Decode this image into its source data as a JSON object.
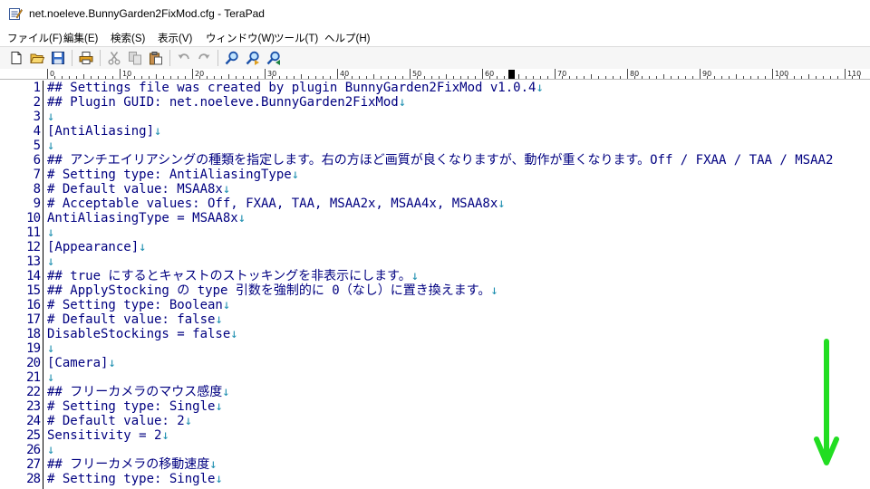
{
  "window": {
    "title": "net.noeleve.BunnyGarden2FixMod.cfg - TeraPad",
    "icon": "terapad-notepad-icon"
  },
  "menu": [
    "ファイル(F)",
    "編集(E)",
    "検索(S)",
    "表示(V)",
    "ウィンドウ(W)",
    "ツール(T)",
    "ヘルプ(H)"
  ],
  "toolbar": [
    {
      "name": "new-file-icon"
    },
    {
      "name": "open-folder-icon"
    },
    {
      "name": "save-icon"
    },
    {
      "name": "print-icon"
    },
    {
      "name": "cut-icon"
    },
    {
      "name": "copy-icon"
    },
    {
      "name": "paste-icon"
    },
    {
      "name": "undo-icon"
    },
    {
      "name": "redo-icon"
    },
    {
      "name": "find-icon"
    },
    {
      "name": "find-next-icon"
    },
    {
      "name": "find-prev-icon"
    }
  ],
  "ruler": {
    "labels": [
      "0",
      "10",
      "20",
      "30",
      "40",
      "50",
      "60",
      "70",
      "80",
      "90",
      "100",
      "110"
    ],
    "caret_column": 64
  },
  "editor": {
    "lines": [
      {
        "n": "1",
        "text": "## Settings file was created by plugin BunnyGarden2FixMod v1.0.4",
        "eol": "↓"
      },
      {
        "n": "2",
        "text": "## Plugin GUID: net.noeleve.BunnyGarden2FixMod",
        "eol": "↓"
      },
      {
        "n": "3",
        "text": "",
        "eol": "↓"
      },
      {
        "n": "4",
        "text": "[AntiAliasing]",
        "eol": "↓"
      },
      {
        "n": "5",
        "text": "",
        "eol": "↓"
      },
      {
        "n": "6",
        "text": "## アンチエイリアシングの種類を指定します。右の方ほど画質が良くなりますが、動作が重くなります。Off / FXAA / TAA / MSAA2",
        "eol": ""
      },
      {
        "n": "7",
        "text": "# Setting type: AntiAliasingType",
        "eol": "↓"
      },
      {
        "n": "8",
        "text": "# Default value: MSAA8x",
        "eol": "↓"
      },
      {
        "n": "9",
        "text": "# Acceptable values: Off, FXAA, TAA, MSAA2x, MSAA4x, MSAA8x",
        "eol": "↓"
      },
      {
        "n": "10",
        "text": "AntiAliasingType = MSAA8x",
        "eol": "↓"
      },
      {
        "n": "11",
        "text": "",
        "eol": "↓"
      },
      {
        "n": "12",
        "text": "[Appearance]",
        "eol": "↓"
      },
      {
        "n": "13",
        "text": "",
        "eol": "↓"
      },
      {
        "n": "14",
        "text": "## true にするとキャストのストッキングを非表示にします。",
        "eol": "↓"
      },
      {
        "n": "15",
        "text": "## ApplyStocking の type 引数を強制的に 0（なし）に置き換えます。",
        "eol": "↓"
      },
      {
        "n": "16",
        "text": "# Setting type: Boolean",
        "eol": "↓"
      },
      {
        "n": "17",
        "text": "# Default value: false",
        "eol": "↓"
      },
      {
        "n": "18",
        "text": "DisableStockings = false",
        "eol": "↓"
      },
      {
        "n": "19",
        "text": "",
        "eol": "↓"
      },
      {
        "n": "20",
        "text": "[Camera]",
        "eol": "↓"
      },
      {
        "n": "21",
        "text": "",
        "eol": "↓"
      },
      {
        "n": "22",
        "text": "## フリーカメラのマウス感度",
        "eol": "↓"
      },
      {
        "n": "23",
        "text": "# Setting type: Single",
        "eol": "↓"
      },
      {
        "n": "24",
        "text": "# Default value: 2",
        "eol": "↓"
      },
      {
        "n": "25",
        "text": "Sensitivity = 2",
        "eol": "↓"
      },
      {
        "n": "26",
        "text": "",
        "eol": "↓"
      },
      {
        "n": "27",
        "text": "## フリーカメラの移動速度",
        "eol": "↓"
      },
      {
        "n": "28",
        "text": "# Setting type: Single",
        "eol": "↓"
      }
    ]
  },
  "annotation": {
    "icon": "down-arrow-icon",
    "color": "#22dd22"
  },
  "colors": {
    "text": "#000080",
    "eol_mark": "#1e8fb0",
    "background": "#ffffff"
  }
}
